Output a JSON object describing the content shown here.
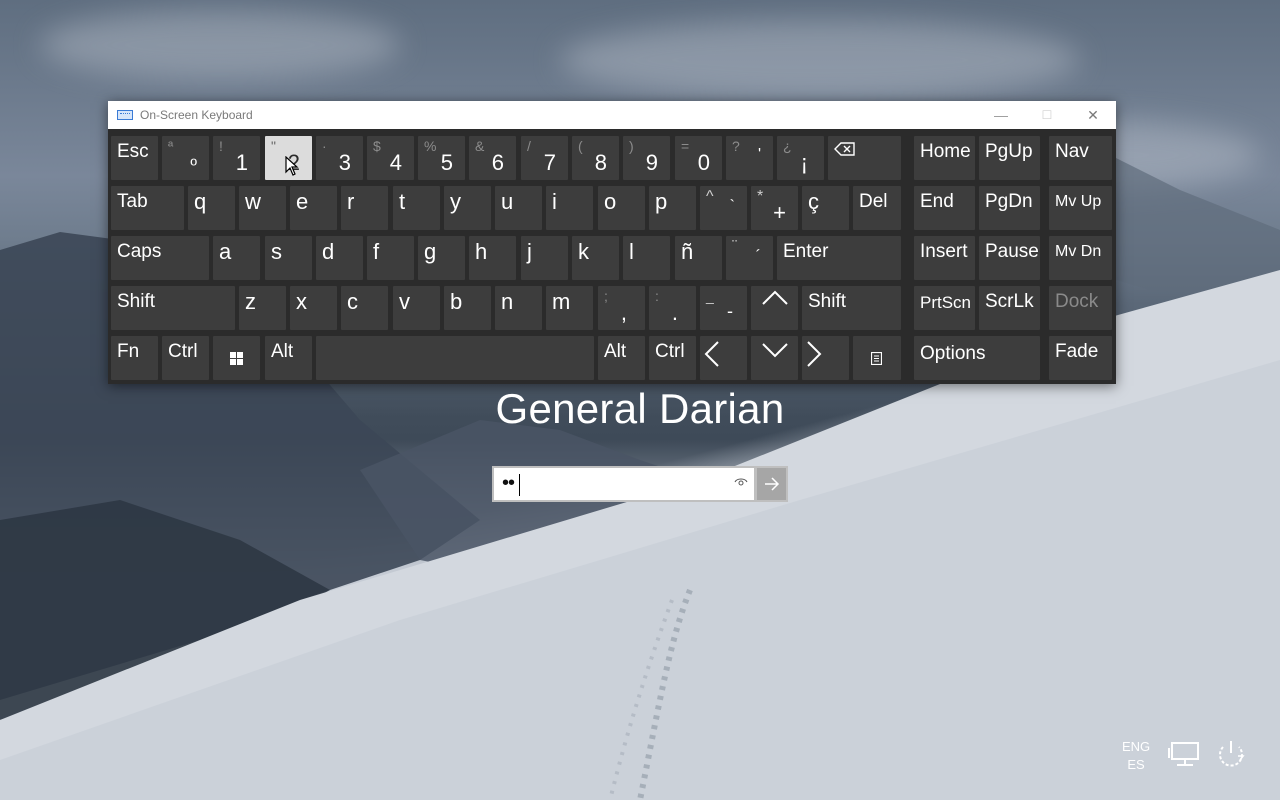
{
  "window": {
    "title": "On-Screen Keyboard",
    "minimize": "—",
    "maximize": "☐",
    "close": "✕"
  },
  "keys": {
    "esc": "Esc",
    "num_row": [
      {
        "top": "ª",
        "main": "º"
      },
      {
        "top": "!",
        "main": "1"
      },
      {
        "top": "\"",
        "main": "2"
      },
      {
        "top": "·",
        "main": "3"
      },
      {
        "top": "$",
        "main": "4"
      },
      {
        "top": "%",
        "main": "5"
      },
      {
        "top": "&",
        "main": "6"
      },
      {
        "top": "/",
        "main": "7"
      },
      {
        "top": "(",
        "main": "8"
      },
      {
        "top": ")",
        "main": "9"
      },
      {
        "top": "=",
        "main": "0"
      },
      {
        "top": "?",
        "main": "'"
      },
      {
        "top": "¿",
        "main": "¡"
      }
    ],
    "tab": "Tab",
    "q_row": [
      "q",
      "w",
      "e",
      "r",
      "t",
      "y",
      "u",
      "i",
      "o",
      "p"
    ],
    "grave": {
      "top": "^",
      "main": "`"
    },
    "plus": {
      "top": "*",
      "main": "+"
    },
    "cedilla": "ç",
    "del": "Del",
    "caps": "Caps",
    "a_row": [
      "a",
      "s",
      "d",
      "f",
      "g",
      "h",
      "j",
      "k",
      "l",
      "ñ"
    ],
    "acute": {
      "top": "¨",
      "main": "´"
    },
    "enter": "Enter",
    "shift_left": "Shift",
    "z_row": [
      "z",
      "x",
      "c",
      "v",
      "b",
      "n",
      "m"
    ],
    "comma": {
      "top": ";",
      "main": ","
    },
    "period": {
      "top": ":",
      "main": "."
    },
    "dash": {
      "top": "_",
      "main": "-"
    },
    "shift_right": "Shift",
    "fn": "Fn",
    "ctrl_left": "Ctrl",
    "alt_left": "Alt",
    "alt_right": "Alt",
    "ctrl_right": "Ctrl",
    "home": "Home",
    "pgup": "PgUp",
    "nav": "Nav",
    "end": "End",
    "pgdn": "PgDn",
    "mvup": "Mv Up",
    "insert": "Insert",
    "pause": "Pause",
    "mvdn": "Mv Dn",
    "prtscn": "PrtScn",
    "scrlk": "ScrLk",
    "dock": "Dock",
    "options": "Options",
    "fade": "Fade"
  },
  "login": {
    "user_name": "General Darian",
    "password_mask": "••"
  },
  "tray": {
    "lang_top": "ENG",
    "lang_bottom": "ES"
  }
}
